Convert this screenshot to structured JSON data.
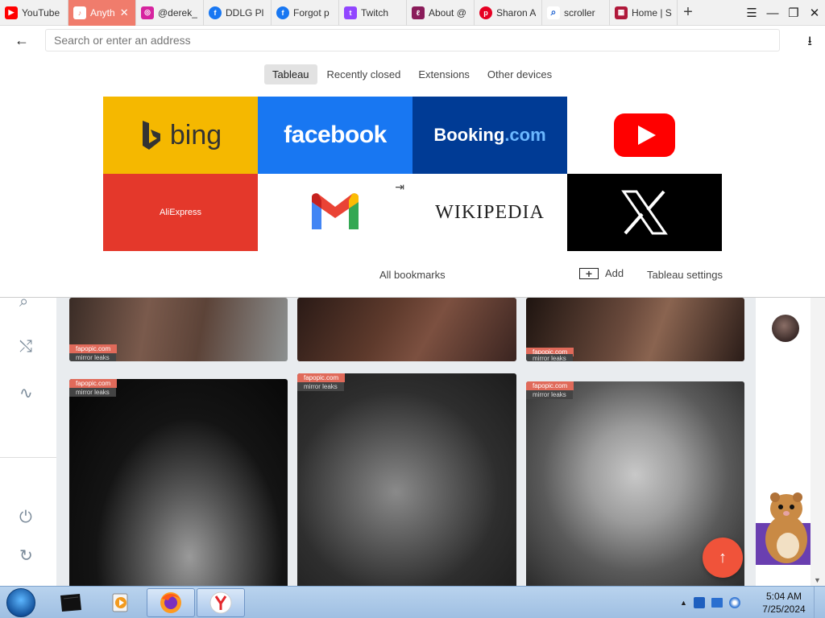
{
  "tabs": [
    {
      "label": "YouTube",
      "icon": "youtube-icon",
      "color": "#ff0000",
      "glyph": "▶"
    },
    {
      "label": "Anyth",
      "icon": "music-icon",
      "color": "#ffffff",
      "glyph": "♪",
      "active": true
    },
    {
      "label": "@derek_",
      "icon": "instagram-icon",
      "color": "#d6249f",
      "glyph": "◎"
    },
    {
      "label": "DDLG Pl",
      "icon": "facebook-icon",
      "color": "#1877f2",
      "glyph": "f"
    },
    {
      "label": "Forgot p",
      "icon": "facebook-icon",
      "color": "#1877f2",
      "glyph": "f"
    },
    {
      "label": "Twitch",
      "icon": "twitch-icon",
      "color": "#9146ff",
      "glyph": "t"
    },
    {
      "label": "About @",
      "icon": "app-icon",
      "color": "#8a1c5a",
      "glyph": "ℓ"
    },
    {
      "label": "Sharon A",
      "icon": "pinterest-icon",
      "color": "#e60023",
      "glyph": "p"
    },
    {
      "label": "scroller",
      "icon": "search-icon",
      "color": "#ffffff",
      "glyph": "⌕"
    },
    {
      "label": "Home | S",
      "icon": "tile-icon",
      "color": "#b0183a",
      "glyph": "▦"
    }
  ],
  "address": {
    "placeholder": "Search or enter an address",
    "value": ""
  },
  "panel_tabs": [
    {
      "label": "Tableau",
      "selected": true
    },
    {
      "label": "Recently closed"
    },
    {
      "label": "Extensions"
    },
    {
      "label": "Other devices"
    }
  ],
  "tiles": {
    "bing": "bing",
    "facebook": "facebook",
    "booking_main": "Booking",
    "booking_dot": ".com",
    "aliexpress": "AliExpress",
    "wikipedia": "WIKIPEDIA"
  },
  "panel_footer": {
    "all_bookmarks": "All bookmarks",
    "add": "Add",
    "settings": "Tableau settings"
  },
  "cards": [
    {
      "badge1": "fapopic.com",
      "badge2": "mirror leaks"
    },
    {
      "badge1": "",
      "badge2": ""
    },
    {
      "badge1": "fapopic.com",
      "badge2": "mirror leaks"
    },
    {
      "badge1": "fapopic.com",
      "badge2": "mirror leaks"
    },
    {
      "badge1": "fapopic.com",
      "badge2": "mirror leaks"
    },
    {
      "badge1": "fapopic.com",
      "badge2": "mirror leaks"
    }
  ],
  "taskbar": {
    "time": "5:04 AM",
    "date": "7/25/2024"
  },
  "colors": {
    "accent_tab": "#f07c6c",
    "fab": "#f0533a",
    "bing": "#f5b800",
    "facebook": "#1877f2",
    "booking": "#003b95",
    "aliexpress": "#e4382b"
  }
}
